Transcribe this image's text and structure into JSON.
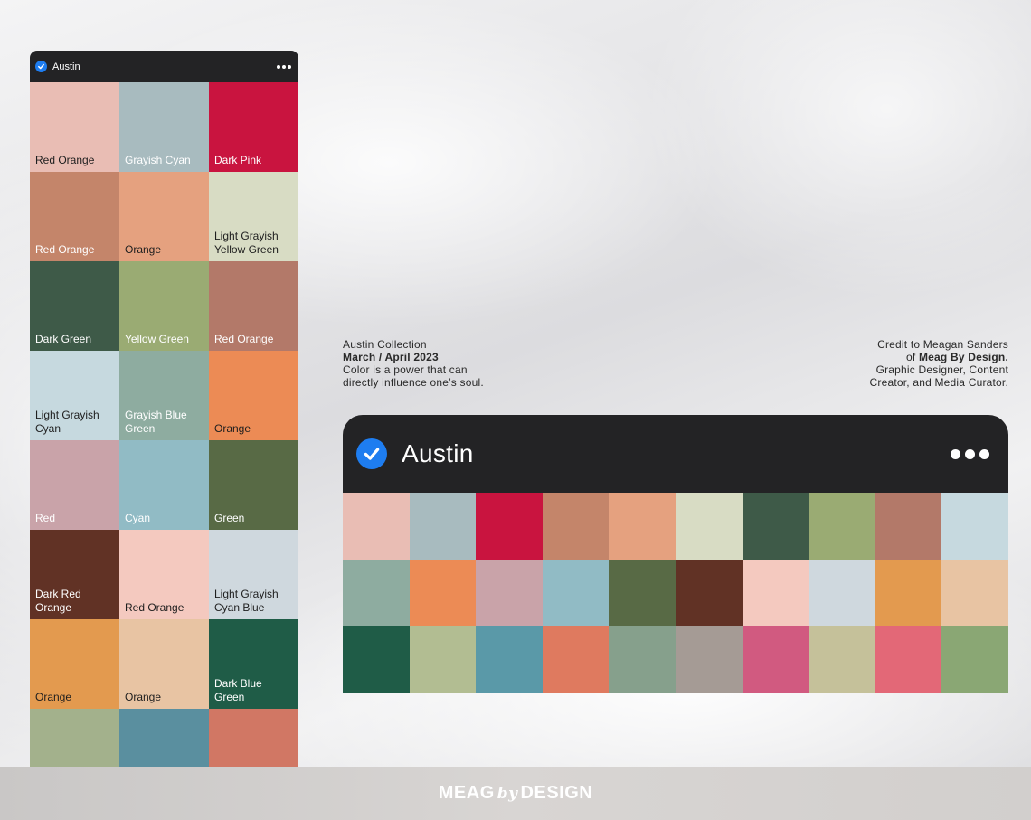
{
  "left_panel": {
    "title": "Austin",
    "swatches": [
      {
        "label": "Red Orange",
        "color": "#e9bdb4",
        "text": "#1e1e1e"
      },
      {
        "label": "Grayish Cyan",
        "color": "#a8bbbf",
        "text": "#ffffff"
      },
      {
        "label": "Dark Pink",
        "color": "#c9143f",
        "text": "#ffffff"
      },
      {
        "label": "Red Orange",
        "color": "#c4856a",
        "text": "#ffffff"
      },
      {
        "label": "Orange",
        "color": "#e5a17f",
        "text": "#1e1e1e"
      },
      {
        "label": "Light Grayish Yellow Green",
        "color": "#d8dcc4",
        "text": "#1e1e1e"
      },
      {
        "label": "Dark Green",
        "color": "#3e5a48",
        "text": "#ffffff"
      },
      {
        "label": "Yellow Green",
        "color": "#9aab73",
        "text": "#ffffff"
      },
      {
        "label": "Red Orange",
        "color": "#b37969",
        "text": "#ffffff"
      },
      {
        "label": "Light Grayish Cyan",
        "color": "#c6d9df",
        "text": "#1e1e1e"
      },
      {
        "label": "Grayish Blue Green",
        "color": "#8eaca0",
        "text": "#ffffff"
      },
      {
        "label": "Orange",
        "color": "#ec8b55",
        "text": "#1e1e1e"
      },
      {
        "label": "Red",
        "color": "#c9a3a9",
        "text": "#ffffff"
      },
      {
        "label": "Cyan",
        "color": "#91bbc5",
        "text": "#ffffff"
      },
      {
        "label": "Green",
        "color": "#586a45",
        "text": "#ffffff"
      },
      {
        "label": "Dark Red Orange",
        "color": "#613225",
        "text": "#ffffff"
      },
      {
        "label": "Red Orange",
        "color": "#f4c9bf",
        "text": "#1e1e1e"
      },
      {
        "label": "Light Grayish Cyan Blue",
        "color": "#cfd8de",
        "text": "#1e1e1e"
      },
      {
        "label": "Orange",
        "color": "#e39a4f",
        "text": "#1e1e1e"
      },
      {
        "label": "Orange",
        "color": "#e8c4a3",
        "text": "#1e1e1e"
      },
      {
        "label": "Dark Blue Green",
        "color": "#1f5c47",
        "text": "#ffffff"
      },
      {
        "label": "",
        "color": "#a3b18c",
        "text": "#1e1e1e"
      },
      {
        "label": "",
        "color": "#5a8f9f",
        "text": "#ffffff"
      },
      {
        "label": "",
        "color": "#d17764",
        "text": "#ffffff"
      }
    ]
  },
  "collection": {
    "line1": "Austin Collection",
    "line2": "March / April 2023",
    "line3": "Color is a power that can",
    "line4": "directly influence one’s soul."
  },
  "credit": {
    "line1": "Credit to Meagan Sanders",
    "line2_prefix": "of ",
    "line2_bold": "Meag By Design.",
    "line3": "Graphic Designer, Content",
    "line4": "Creator, and Media Curator."
  },
  "big_palette": {
    "title": "Austin",
    "colors": [
      "#e9bdb4",
      "#a8bbbf",
      "#c9143f",
      "#c4856a",
      "#e5a17f",
      "#d8dcc4",
      "#3e5a48",
      "#9aab73",
      "#b37969",
      "#c6d9df",
      "#8eaca0",
      "#ec8b55",
      "#c9a3a9",
      "#91bbc5",
      "#586a45",
      "#613225",
      "#f4c9bf",
      "#cfd8de",
      "#e39a4f",
      "#e8c4a3",
      "#1f5c47",
      "#b2bd92",
      "#5a99a8",
      "#df7a5f",
      "#86a08c",
      "#a59b95",
      "#d15a80",
      "#c5c19a",
      "#e36877",
      "#8aa774"
    ]
  },
  "footer": {
    "logo_part1": "MEAG",
    "logo_part2": "by",
    "logo_part3": "DESIGN"
  }
}
